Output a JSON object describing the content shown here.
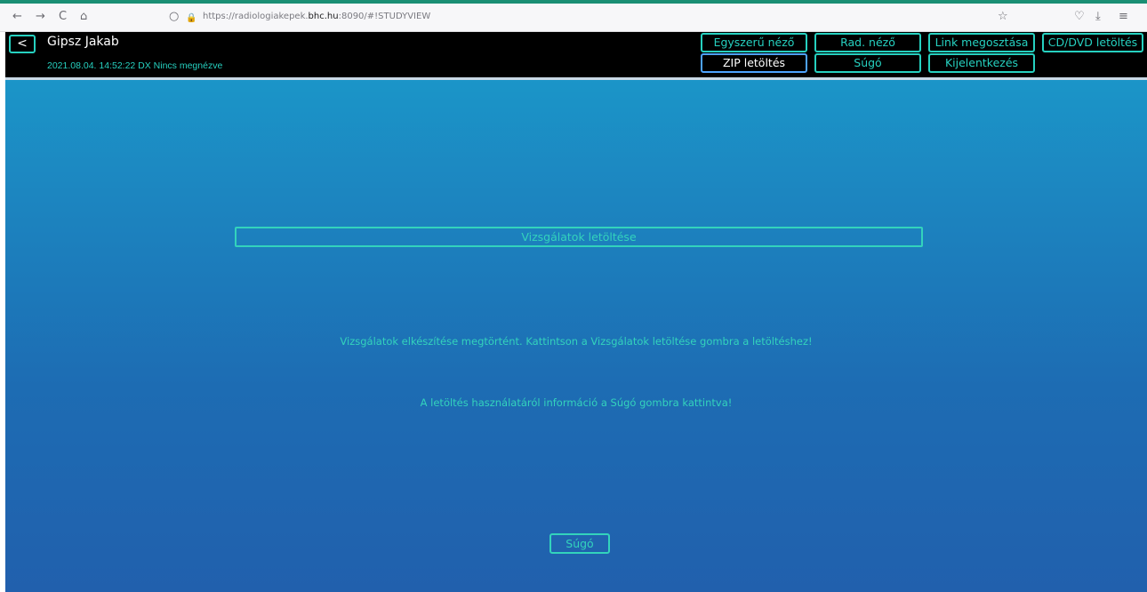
{
  "browser": {
    "back_icon": "←",
    "forward_icon": "→",
    "reload_icon": "C",
    "home_icon": "⌂",
    "shield_icon": "○",
    "lock_icon": "🔒",
    "url_prefix": "https://radiologiakepek.",
    "url_host": "bhc.hu",
    "url_suffix": ":8090/#!STUDYVIEW",
    "bookmark_icon": "☆",
    "pocket_icon": "♡",
    "download_icon": "⤓",
    "menu_icon": "≡"
  },
  "header": {
    "back_label": "<",
    "patient_name": "Gipsz Jakab",
    "study_info": "2021.08.04. 14:52:22 DX Nincs megnézve",
    "buttons": {
      "simple_viewer": "Egyszerű néző",
      "rad_viewer": "Rad. néző",
      "share_link": "Link megosztása",
      "cd_download": "CD/DVD letöltés",
      "zip_download": "ZIP letöltés",
      "help": "Súgó",
      "logout": "Kijelentkezés"
    }
  },
  "main": {
    "download_button": "Vizsgálatok letöltése",
    "message_ready": "Vizsgálatok elkészítése megtörtént. Kattintson a Vizsgálatok letöltése gombra a letöltéshez!",
    "message_help": "A letöltés használatáról információ a Súgó gombra kattintva!",
    "help_button": "Súgó"
  },
  "colors": {
    "accent": "#26d1c0",
    "header_bg": "#000000",
    "main_gradient_top": "#1b95c8",
    "main_gradient_bottom": "#2160ad",
    "active_border": "#4da3ff"
  }
}
